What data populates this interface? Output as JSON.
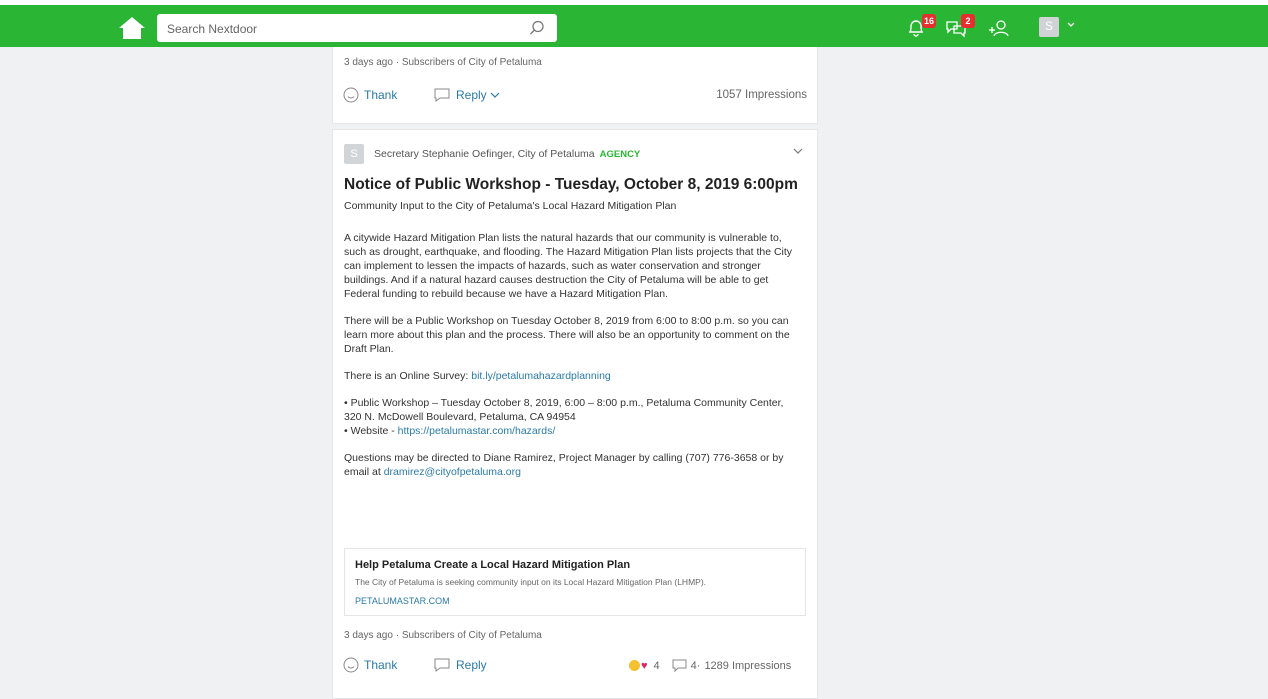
{
  "search": {
    "placeholder": "Search Nextdoor"
  },
  "nav": {
    "notifications_badge": "16",
    "messages_badge": "2"
  },
  "profile": {
    "initial": "S"
  },
  "post1": {
    "meta": "3 days ago · Subscribers of City of Petaluma",
    "thank_label": "Thank",
    "reply_label": "Reply",
    "impressions": "1057 Impressions"
  },
  "post2": {
    "author_initial": "S",
    "author": "Secretary Stephanie Oefinger, City of Petaluma",
    "author_badge": "AGENCY",
    "title": "Notice of Public Workshop - Tuesday, October 8, 2019 6:00pm",
    "subtitle": "Community Input to the City of Petaluma's Local Hazard Mitigation Plan",
    "para1": "A citywide Hazard Mitigation Plan lists the natural hazards that our community is vulnerable to, such as drought, earthquake, and flooding. The Hazard Mitigation Plan lists projects that the City can implement to lessen the impacts of hazards, such as water conservation and stronger buildings. And if a natural hazard causes destruction the City of Petaluma will be able to get Federal funding to rebuild because we have a Hazard Mitigation Plan.",
    "para2": "There will be a Public Workshop on Tuesday October 8, 2019 from 6:00 to 8:00 p.m. so you can learn more about this plan and the process. There will also be an opportunity to comment on the Draft Plan.",
    "survey_prefix": "There is an Online Survey: ",
    "survey_link": "bit.ly/petalumahazardplanning",
    "bullet1": "•     Public Workshop – Tuesday October 8, 2019, 6:00 – 8:00 p.m., Petaluma Community Center, 320 N. McDowell Boulevard, Petaluma, CA 94954",
    "bullet2_prefix": "•     Website - ",
    "bullet2_link": "https://petalumastar.com/hazards/",
    "questions_prefix": "Questions may be directed to Diane Ramirez, Project Manager by calling (707) 776-3658 or by email at ",
    "questions_link": "dramirez@cityofpetaluma.org",
    "preview_title": "Help Petaluma Create a Local Hazard Mitigation Plan",
    "preview_desc": "The City of Petaluma is seeking community input on its Local Hazard Mitigation Plan (LHMP).",
    "preview_domain": "PETALUMASTAR.COM",
    "meta": "3 days ago · Subscribers of City of Petaluma",
    "thank_label": "Thank",
    "reply_label": "Reply",
    "reaction_count": "4",
    "comment_count": "4·",
    "impressions": "1289 Impressions"
  },
  "colors": {
    "brand_green": "#2bb534",
    "link_blue": "#2a7aa8",
    "badge_red": "#e62e2e"
  }
}
